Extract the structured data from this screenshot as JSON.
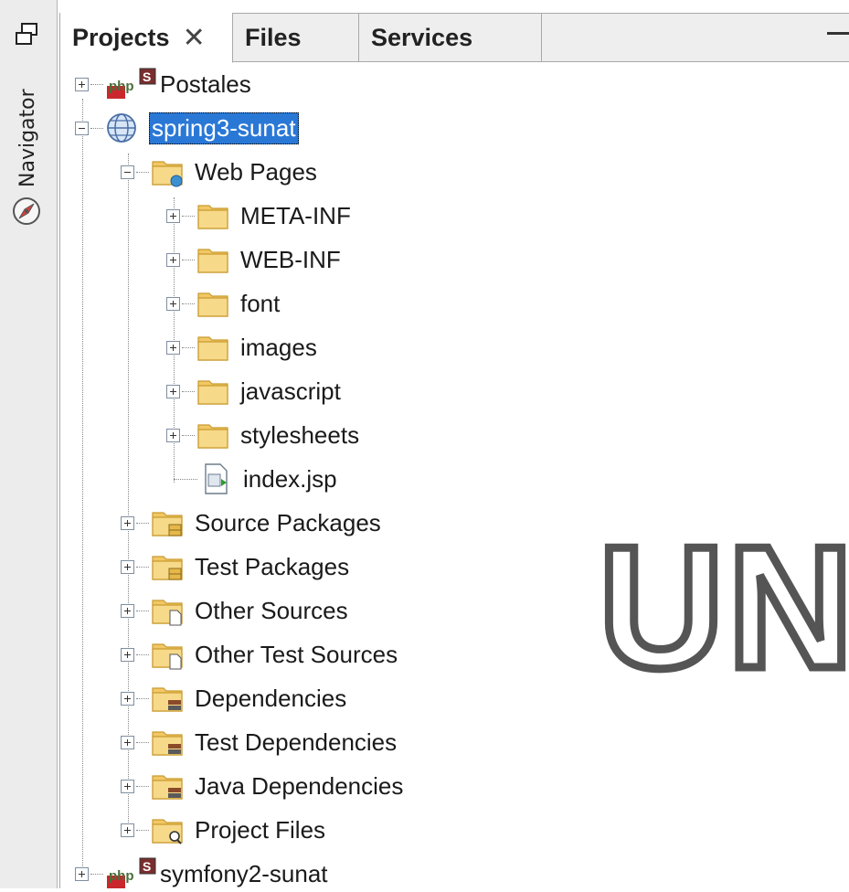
{
  "side": {
    "navigator_label": "Navigator"
  },
  "tabs": [
    {
      "label": "Projects",
      "close": "✕",
      "active": true
    },
    {
      "label": "Files"
    },
    {
      "label": "Services"
    }
  ],
  "tree": {
    "postales": "Postales",
    "spring3": "spring3-sunat",
    "web_pages": "Web Pages",
    "meta_inf": "META-INF",
    "web_inf": "WEB-INF",
    "font": "font",
    "images": "images",
    "javascript": "javascript",
    "stylesheets": "stylesheets",
    "index_jsp": "index.jsp",
    "source_packages": "Source Packages",
    "test_packages": "Test Packages",
    "other_sources": "Other Sources",
    "other_test_sources": "Other Test Sources",
    "dependencies": "Dependencies",
    "test_dependencies": "Test Dependencies",
    "java_dependencies": "Java Dependencies",
    "project_files": "Project Files",
    "symfony2": "symfony2-sunat"
  },
  "editor": {
    "watermark": "UNI"
  },
  "colors": {
    "selection": "#2a78d6",
    "folder": "#f2c866"
  }
}
